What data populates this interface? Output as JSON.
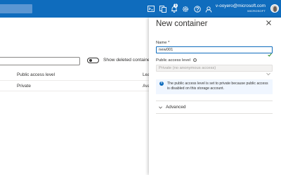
{
  "topbar": {
    "account_email": "v-ooyero@microsoft.com",
    "account_tenant": "MICROSOFT",
    "notification_count": "1",
    "icons": [
      "cloud-shell-icon",
      "directory-filter-icon",
      "notifications-icon",
      "settings-icon",
      "help-icon",
      "feedback-icon"
    ]
  },
  "background": {
    "show_deleted_label": "Show deleted containers",
    "columns": [
      "Public access level",
      "Leas"
    ],
    "row": {
      "access_level": "Private",
      "lease_state": "Avail"
    }
  },
  "panel": {
    "title": "New container",
    "name_label": "Name *",
    "name_value": "new001",
    "access_label": "Public access level",
    "access_value": "Private (no anonymous access)",
    "info_text": "The public access level is set to private because public access is disabled on this storage account.",
    "advanced_label": "Advanced"
  },
  "colors": {
    "topbar": "#0f6cbd",
    "accent": "#0f6cbd",
    "success": "#107c10",
    "info_background": "#f0f6ff"
  }
}
